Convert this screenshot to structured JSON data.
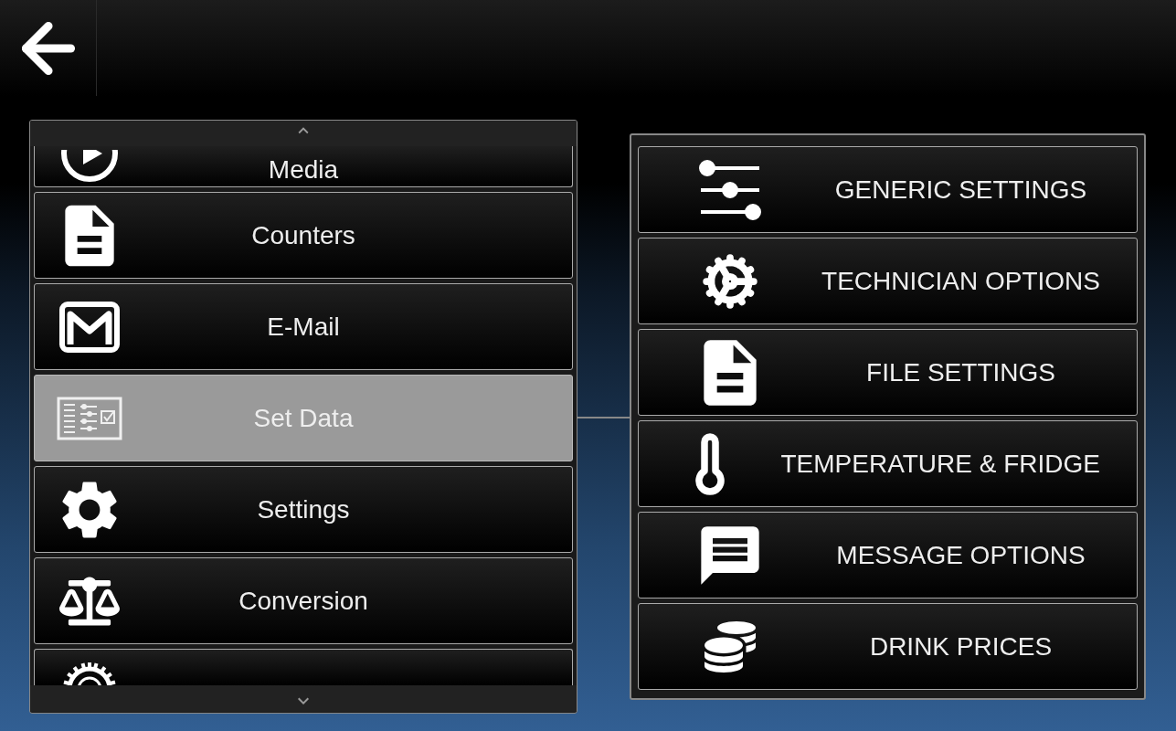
{
  "menu": {
    "items": [
      {
        "label": "Media",
        "selected": false
      },
      {
        "label": "Counters",
        "selected": false
      },
      {
        "label": "E-Mail",
        "selected": false
      },
      {
        "label": "Set Data",
        "selected": true
      },
      {
        "label": "Settings",
        "selected": false
      },
      {
        "label": "Conversion",
        "selected": false
      },
      {
        "selected": false
      }
    ]
  },
  "submenu": {
    "items": [
      {
        "label": "GENERIC SETTINGS"
      },
      {
        "label": "TECHNICIAN OPTIONS"
      },
      {
        "label": "FILE SETTINGS"
      },
      {
        "label": "TEMPERATURE & FRIDGE"
      },
      {
        "label": "MESSAGE OPTIONS"
      },
      {
        "label": "DRINK PRICES"
      }
    ]
  }
}
